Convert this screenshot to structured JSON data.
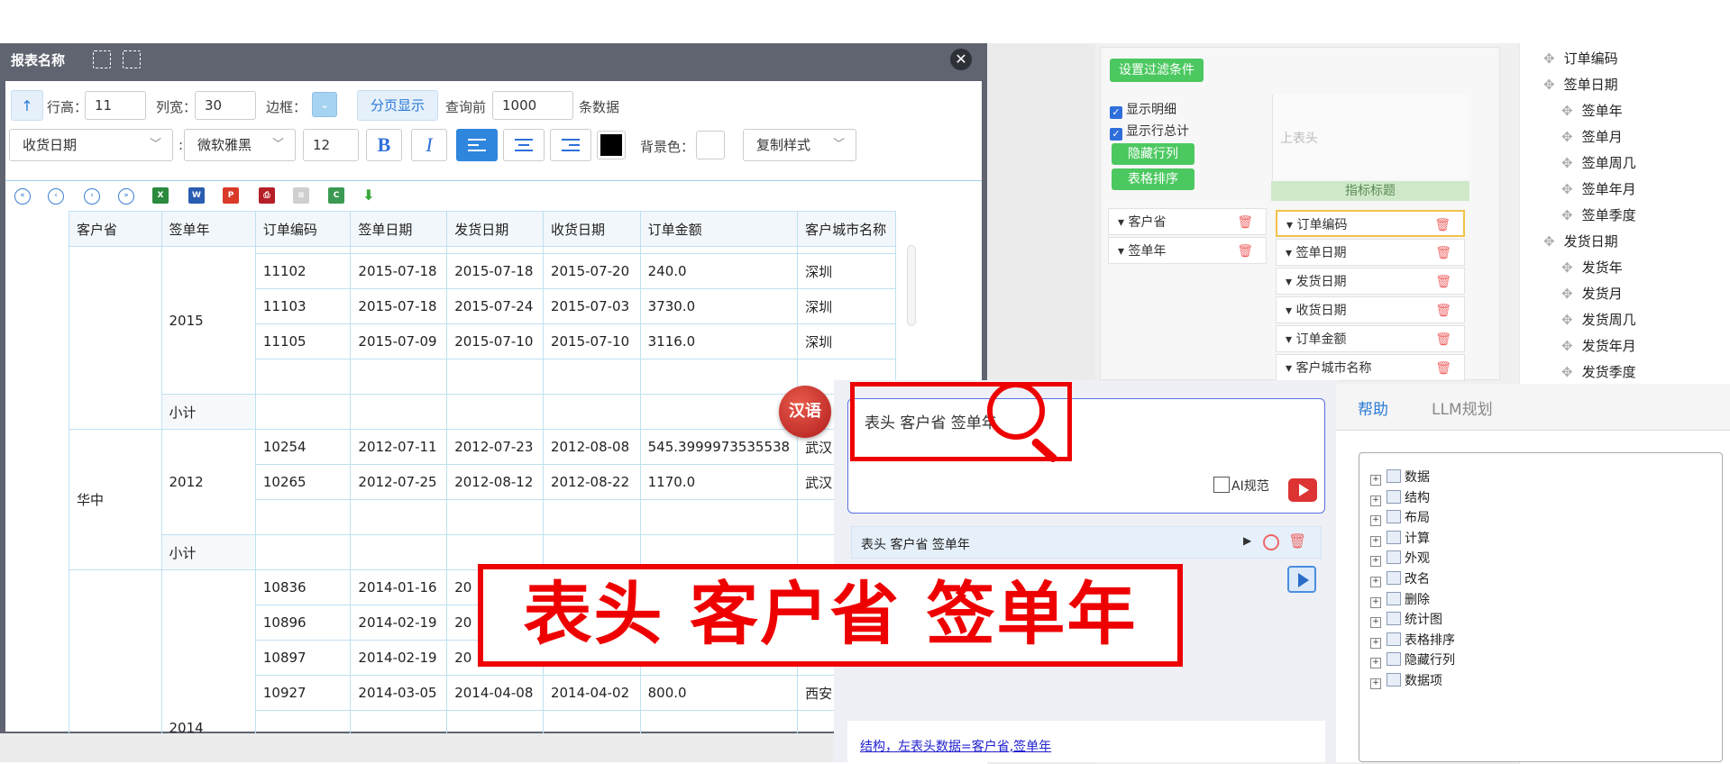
{
  "report_window": {
    "title": "报表名称",
    "close_glyph": "✕",
    "toolbar": {
      "sort_glyph": "↑",
      "row_height_label": "行高：",
      "row_height_value": "11",
      "col_width_label": "列宽：",
      "col_width_value": "30",
      "border_label": "边框：",
      "pagination_label": "分页显示",
      "query_before_label": "查询前",
      "query_count_value": "1000",
      "rows_unit_label": "条数据",
      "field_select": "收货日期",
      "colon": ":",
      "font_select": "微软雅黑",
      "font_size_value": "12",
      "bold_glyph": "B",
      "italic_glyph": "I",
      "bg_color_label": "背景色：",
      "copy_style_select": "复制样式"
    },
    "pager_icons": [
      "first-page-icon",
      "prev-page-icon",
      "next-page-icon",
      "last-page-icon"
    ],
    "export_icons": [
      "excel-icon",
      "word-icon",
      "pdf-icon",
      "print-icon",
      "text-icon",
      "csv-icon",
      "download-icon"
    ],
    "table": {
      "headers": [
        "客户省",
        "签单年",
        "订单编码",
        "签单日期",
        "发货日期",
        "收货日期",
        "订单金额",
        "客户城市名称"
      ],
      "subtotal_label": "小计",
      "group_2015": {
        "year": "2015"
      },
      "group_huazhong": {
        "province": "华中",
        "year_2012": "2012",
        "year_2014": "2014"
      },
      "rows_2015": [
        [
          "11102",
          "2015-07-18",
          "2015-07-18",
          "2015-07-20",
          "240.0",
          "深圳"
        ],
        [
          "11103",
          "2015-07-18",
          "2015-07-24",
          "2015-07-03",
          "3730.0",
          "深圳"
        ],
        [
          "11105",
          "2015-07-09",
          "2015-07-10",
          "2015-07-10",
          "3116.0",
          "深圳"
        ]
      ],
      "rows_2012": [
        [
          "10254",
          "2012-07-11",
          "2012-07-23",
          "2012-08-08",
          "545.3999973535538",
          "武汉"
        ],
        [
          "10265",
          "2012-07-25",
          "2012-08-12",
          "2012-08-22",
          "1170.0",
          "武汉"
        ]
      ],
      "rows_2014": [
        [
          "10836",
          "2014-01-16",
          "20",
          "",
          "",
          ""
        ],
        [
          "10896",
          "2014-02-19",
          "20",
          "",
          "",
          ""
        ],
        [
          "10897",
          "2014-02-19",
          "20",
          "",
          "",
          ""
        ],
        [
          "10927",
          "2014-03-05",
          "2014-04-08",
          "2014-04-02",
          "800.0",
          "西安"
        ]
      ]
    }
  },
  "filter_panel": {
    "set_filter_button": "设置过滤条件",
    "show_detail": "显示明细",
    "show_row_total": "显示行总计",
    "hide_rows_cols_button": "隐藏行列",
    "table_sort_button": "表格排序",
    "upper_header_placeholder": "上表头",
    "indicator_title": "指标标题",
    "left_dims": [
      "客户省",
      "签单年"
    ],
    "indicators": [
      "订单编码",
      "签单日期",
      "发货日期",
      "收货日期",
      "订单金额",
      "客户城市名称"
    ]
  },
  "field_tree": [
    {
      "label": "订单编码",
      "level": 0
    },
    {
      "label": "签单日期",
      "level": 0
    },
    {
      "label": "签单年",
      "level": 1
    },
    {
      "label": "签单月",
      "level": 1
    },
    {
      "label": "签单周几",
      "level": 1
    },
    {
      "label": "签单年月",
      "level": 1
    },
    {
      "label": "签单季度",
      "level": 1
    },
    {
      "label": "发货日期",
      "level": 0
    },
    {
      "label": "发货年",
      "level": 1
    },
    {
      "label": "发货月",
      "level": 1
    },
    {
      "label": "发货周几",
      "level": 1
    },
    {
      "label": "发货年月",
      "level": 1
    },
    {
      "label": "发货季度",
      "level": 1
    }
  ],
  "assistant": {
    "lang_badge": "汉语",
    "input_text": "表头 客户省 签单年",
    "ai_spec_label": "AI规范",
    "command_item": "表头 客户省 签单年",
    "link_text": "结构，左表头数据=客户省,签单年",
    "callout_text": "表头 客户省 签单年"
  },
  "help_panel": {
    "tabs": [
      "帮助",
      "LLM规划"
    ],
    "active_tab": "帮助",
    "nodes": [
      "数据",
      "结构",
      "布局",
      "计算",
      "外观",
      "改名",
      "删除",
      "统计图",
      "表格排序",
      "隐藏行列",
      "数据项"
    ]
  },
  "colors": {
    "accent_blue": "#2f86dd",
    "green_button": "#4cc860",
    "callout_red": "#e00000",
    "title_bar": "#5f6470"
  }
}
